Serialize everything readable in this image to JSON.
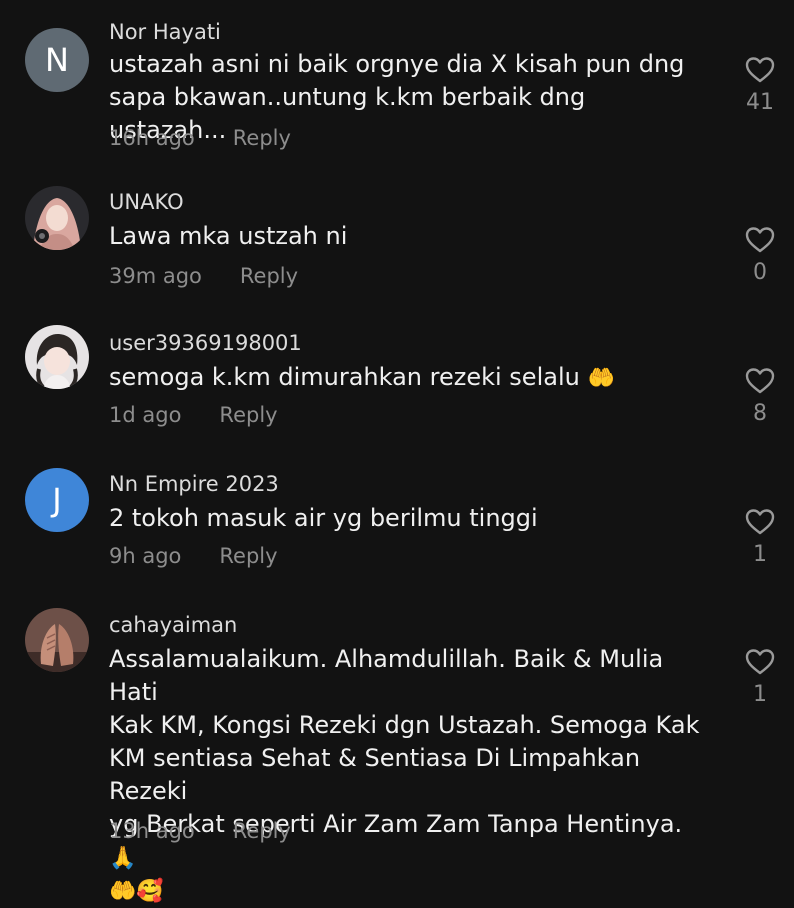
{
  "comments": [
    {
      "username": "Nor Hayati",
      "avatar_letter": "N",
      "avatar_color": "#5f6a73",
      "text_lines": [
        "ustazah asni ni baik orgnye dia X kisah pun dng",
        "sapa bkawan..untung k.km berbaik dng ustazah..."
      ],
      "time": "16h ago",
      "reply_label": "Reply",
      "likes": "41"
    },
    {
      "username": "UNAKO",
      "avatar_icon": "profile-photo-hijab-woman",
      "text_lines": [
        "Lawa mka ustzah ni"
      ],
      "time": "39m ago",
      "reply_label": "Reply",
      "likes": "0"
    },
    {
      "username": "user39369198001",
      "avatar_icon": "profile-photo-girl",
      "text_lines": [
        "semoga k.km dimurahkan rezeki selalu"
      ],
      "emoji_after": "🤲",
      "time": "1d ago",
      "reply_label": "Reply",
      "likes": "8"
    },
    {
      "username": "Nn Empire 2023",
      "avatar_letter": "J",
      "avatar_color": "#3f86d8",
      "text_lines": [
        "2 tokoh masuk air yg berilmu tinggi"
      ],
      "time": "9h ago",
      "reply_label": "Reply",
      "likes": "1"
    },
    {
      "username": "cahayaiman",
      "avatar_icon": "profile-photo-praying-hands",
      "text_lines": [
        "Assalamualaikum. Alhamdulillah. Baik & Mulia Hati",
        "Kak KM, Kongsi Rezeki dgn Ustazah. Semoga Kak",
        "KM sentiasa Sehat & Sentiasa Di Limpahkan Rezeki",
        "yg Berkat seperti Air Zam Zam Tanpa Hentinya."
      ],
      "emoji_line4": "🙏",
      "emoji_line5": "🤲🥰",
      "time": "13h ago",
      "reply_label": "Reply",
      "likes": "1"
    }
  ],
  "icons": {
    "like": "heart-outline-icon"
  }
}
